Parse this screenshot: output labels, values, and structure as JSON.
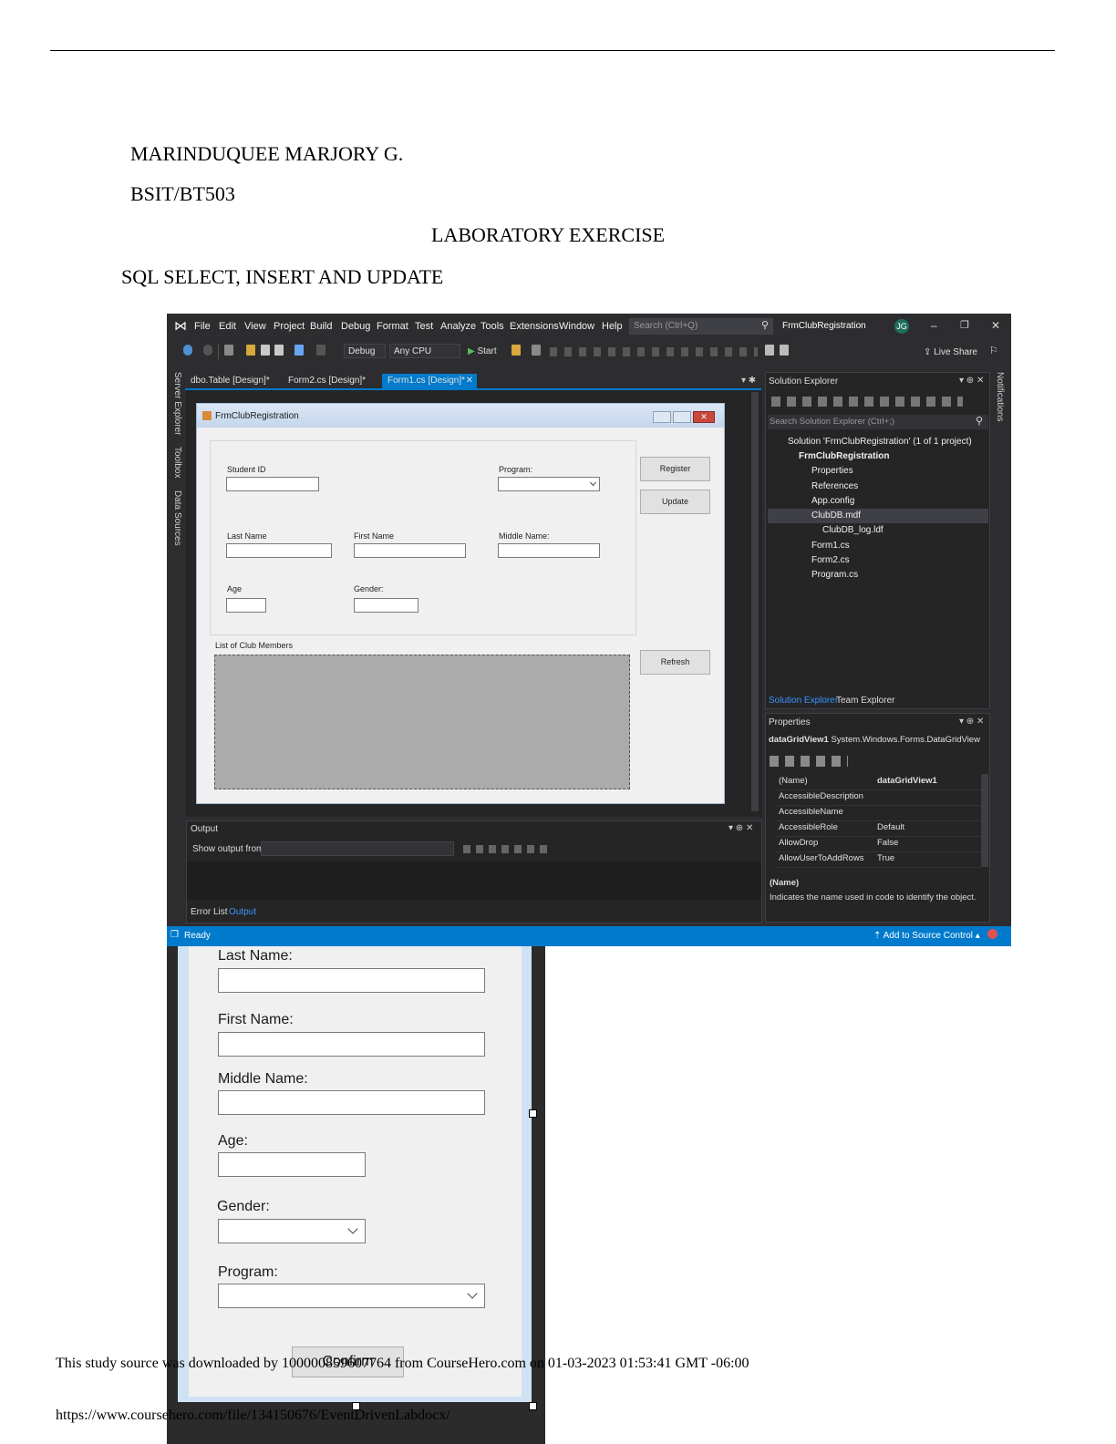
{
  "document": {
    "name": "MARINDUQUEE MARJORY G.",
    "section": "BSIT/BT503",
    "title": "LABORATORY EXERCISE",
    "subtitle": "SQL SELECT, INSERT AND UPDATE"
  },
  "vs": {
    "menu": [
      "File",
      "Edit",
      "View",
      "Project",
      "Build",
      "Debug",
      "Format",
      "Test",
      "Analyze",
      "Tools",
      "Extensions",
      "Window",
      "Help"
    ],
    "search_placeholder": "Search (Ctrl+Q)",
    "solution_title": "FrmClubRegistration",
    "user_initials": "JG",
    "toolbar": {
      "config": "Debug",
      "platform": "Any CPU",
      "start": "Start",
      "live_share": "Live Share"
    },
    "side_tabs": [
      "Server Explorer",
      "Toolbox",
      "Data Sources"
    ],
    "right_side_tab": "Notifications",
    "doc_tabs": [
      "dbo.Table [Design]*",
      "Form2.cs [Design]*",
      "Form1.cs [Design]*"
    ],
    "form": {
      "title": "FrmClubRegistration",
      "labels": {
        "student_id": "Student ID",
        "program": "Program:",
        "last_name": "Last Name",
        "first_name": "First Name",
        "middle_name": "Middle Name:",
        "age": "Age",
        "gender": "Gender:",
        "list": "List of Club Members"
      },
      "buttons": {
        "register": "Register",
        "update": "Update",
        "refresh": "Refresh"
      }
    },
    "output": {
      "title": "Output",
      "show_from": "Show output from:",
      "tabs": [
        "Error List",
        "Output"
      ]
    },
    "solution_explorer": {
      "title": "Solution Explorer",
      "search": "Search Solution Explorer (Ctrl+;)",
      "items": [
        "Solution 'FrmClubRegistration' (1 of 1 project)",
        "FrmClubRegistration",
        "Properties",
        "References",
        "App.config",
        "ClubDB.mdf",
        "ClubDB_log.ldf",
        "Form1.cs",
        "Form2.cs",
        "Program.cs"
      ],
      "tabs": [
        "Solution Explorer",
        "Team Explorer"
      ]
    },
    "properties": {
      "title": "Properties",
      "object": "dataGridView1",
      "type": "System.Windows.Forms.DataGridView",
      "rows": [
        {
          "name": "(Name)",
          "value": "dataGridView1"
        },
        {
          "name": "AccessibleDescription",
          "value": ""
        },
        {
          "name": "AccessibleName",
          "value": ""
        },
        {
          "name": "AccessibleRole",
          "value": "Default"
        },
        {
          "name": "AllowDrop",
          "value": "False"
        },
        {
          "name": "AllowUserToAddRows",
          "value": "True"
        }
      ],
      "desc_title": "(Name)",
      "desc_text": "Indicates the name used in code to identify the object."
    },
    "status": {
      "ready": "Ready",
      "source_control": "Add to Source Control"
    }
  },
  "lower_form": {
    "labels": [
      "Last Name:",
      "First Name:",
      "Middle Name:",
      "Age:",
      "Gender:",
      "Program:"
    ],
    "button": "Confirm"
  },
  "footer": {
    "line1": "This study source was downloaded by 100000859607764 from CourseHero.com on 01-03-2023 01:53:41 GMT -06:00",
    "line2": "https://www.coursehero.com/file/134150676/EventDrivenLabdocx/"
  },
  "colors": {
    "vs_bg": "#2d2d30",
    "status_bar": "#007acc",
    "accent": "#3794ff"
  }
}
